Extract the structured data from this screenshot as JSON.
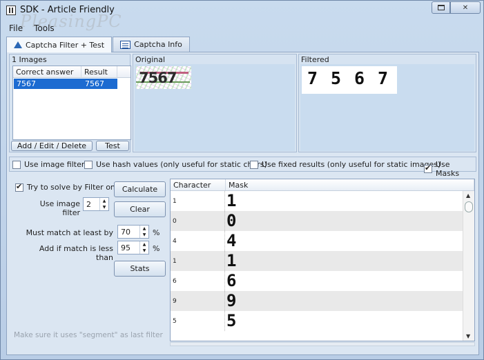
{
  "window": {
    "title": "SDK - Article Friendly",
    "watermark_text": "PC",
    "watermark_prefix": "Pleasing"
  },
  "menu": [
    "File",
    "Tools"
  ],
  "tabs": [
    {
      "label": "Captcha Filter + Test",
      "icon": "flask-icon"
    },
    {
      "label": "Captcha Info",
      "icon": "form-icon"
    }
  ],
  "images_panel": {
    "label": "1 Images",
    "columns": [
      "Correct answer",
      "Result"
    ],
    "rows": [
      {
        "answer": "7567",
        "result": "7567"
      }
    ],
    "buttons": {
      "edit": "Add / Edit / Delete",
      "test": "Test"
    }
  },
  "original_panel": {
    "label": "Original",
    "captcha_text": "7567"
  },
  "filtered_panel": {
    "label": "Filtered",
    "digits": [
      "7",
      "5",
      "6",
      "7"
    ]
  },
  "options": {
    "use_image_filter": {
      "label": "Use image filter",
      "checked": false
    },
    "use_hash_values": {
      "label": "Use hash values (only useful for static chars)",
      "checked": false
    },
    "use_fixed_results": {
      "label": "Use fixed results (only useful for static images)",
      "checked": false
    },
    "use_masks": {
      "label": "Use Masks",
      "checked": true
    }
  },
  "solver": {
    "try_filter_only": {
      "label": "Try to solve by Filter only",
      "checked": true
    },
    "use_image_filter_label": "Use image filter",
    "use_image_filter_value": "2",
    "must_match_label": "Must match at least by",
    "must_match_value": "70",
    "add_if_less_label": "Add if match is less than",
    "add_if_less_value": "95",
    "percent": "%",
    "buttons": {
      "calculate": "Calculate",
      "clear": "Clear",
      "stats": "Stats"
    }
  },
  "mask_grid": {
    "columns": [
      "Character",
      "Mask"
    ],
    "rows": [
      {
        "char": "1",
        "mask": "1"
      },
      {
        "char": "0",
        "mask": "0"
      },
      {
        "char": "4",
        "mask": "4"
      },
      {
        "char": "1",
        "mask": "1"
      },
      {
        "char": "6",
        "mask": "6"
      },
      {
        "char": "9",
        "mask": "9"
      },
      {
        "char": "5",
        "mask": "5"
      }
    ]
  },
  "hint": "Make sure it uses \"segment\" as last filter"
}
